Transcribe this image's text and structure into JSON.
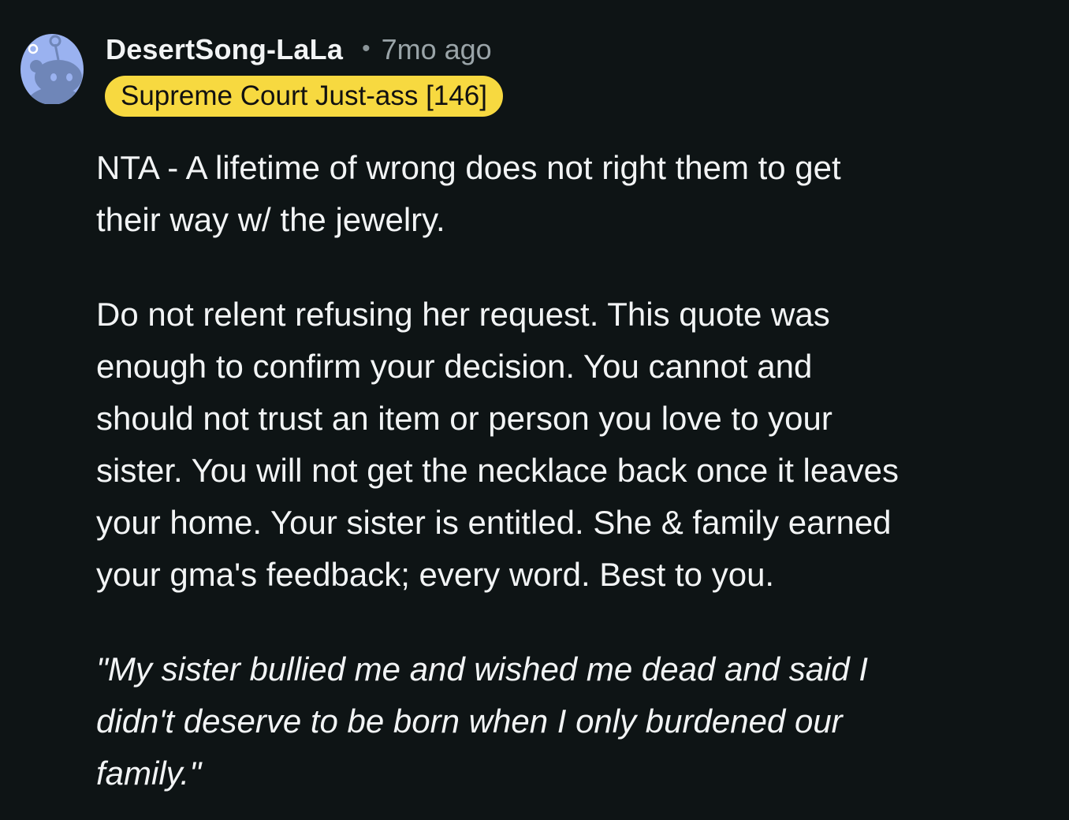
{
  "comment": {
    "avatar_icon": "reddit-snoo-avatar-icon",
    "username": "DesertSong-LaLa",
    "separator": "•",
    "timestamp": "7mo ago",
    "flair": "Supreme Court Just-ass [146]",
    "flair_color": "#f7d940",
    "paragraphs": [
      "NTA - A lifetime of wrong does not right them to get\ntheir way w/ the jewelry.",
      "Do not relent refusing her request. This quote was\nenough to confirm your decision. You cannot and\nshould not trust an item or person you love to your\nsister. You will not get the necklace back once it leaves\nyour home. Your sister is entitled. She & family earned\nyour gma's feedback; every word. Best to you.",
      "\"My sister bullied me and wished me dead and said I\ndidn't deserve to be born when I only burdened our\nfamily.\""
    ]
  }
}
